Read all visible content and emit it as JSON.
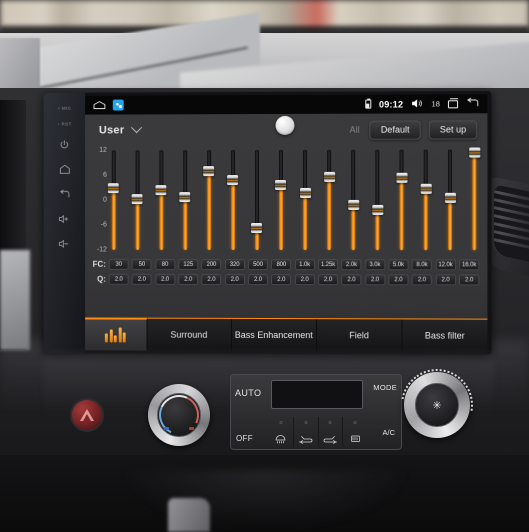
{
  "status_bar": {
    "home_icon": "home-icon",
    "app_icon": "app-shortcut-icon",
    "battery_icon": "battery-icon",
    "clock": "09:12",
    "volume_icon": "volume-icon",
    "volume_level": "18",
    "recent_icon": "recent-apps-icon",
    "back_icon": "back-arrow-icon"
  },
  "topbar": {
    "preset_label": "User",
    "chevron_icon": "chevron-down-icon",
    "center_knob_icon": "balance-knob",
    "all_label": "All",
    "default_label": "Default",
    "setup_label": "Set up"
  },
  "eq": {
    "scale_labels": [
      "12",
      "6",
      "0",
      "-6",
      "-12"
    ],
    "fc_row_label": "FC:",
    "q_row_label": "Q:",
    "bands": [
      {
        "freq": "30",
        "gain": 3.0,
        "q": "2.0"
      },
      {
        "freq": "50",
        "gain": 0.2,
        "q": "2.0"
      },
      {
        "freq": "80",
        "gain": 2.4,
        "q": "2.0"
      },
      {
        "freq": "125",
        "gain": 0.7,
        "q": "2.0"
      },
      {
        "freq": "200",
        "gain": 7.0,
        "q": "2.0"
      },
      {
        "freq": "320",
        "gain": 4.7,
        "q": "2.0"
      },
      {
        "freq": "500",
        "gain": -6.6,
        "q": "2.0"
      },
      {
        "freq": "800",
        "gain": 3.5,
        "q": "2.0"
      },
      {
        "freq": "1.0k",
        "gain": 1.7,
        "q": "2.0"
      },
      {
        "freq": "1.25k",
        "gain": 5.6,
        "q": "2.0"
      },
      {
        "freq": "2.0k",
        "gain": -1.3,
        "q": "2.0"
      },
      {
        "freq": "3.0k",
        "gain": -2.4,
        "q": "2.0"
      },
      {
        "freq": "5.0k",
        "gain": 5.2,
        "q": "2.0"
      },
      {
        "freq": "8.0k",
        "gain": 2.6,
        "q": "2.0"
      },
      {
        "freq": "12.0k",
        "gain": 0.6,
        "q": "2.0"
      },
      {
        "freq": "16.0k",
        "gain": 11.4,
        "q": "2.0"
      }
    ],
    "gain_min": -12,
    "gain_max": 12,
    "accent_color": "#ff8c0f"
  },
  "tabs": [
    {
      "label": "",
      "icon": "equalizer-icon",
      "active": true
    },
    {
      "label": "Surround",
      "icon": "",
      "active": false
    },
    {
      "label": "Bass Enhancement",
      "icon": "",
      "active": false
    },
    {
      "label": "Field",
      "icon": "",
      "active": false
    },
    {
      "label": "Bass filter",
      "icon": "",
      "active": false
    }
  ],
  "hardware_buttons": [
    {
      "label": "MIC",
      "icon": "mic-indicator"
    },
    {
      "label": "RST",
      "icon": "reset-indicator"
    },
    {
      "label": "",
      "icon": "power-icon"
    },
    {
      "label": "",
      "icon": "home-icon"
    },
    {
      "label": "",
      "icon": "back-icon"
    },
    {
      "label": "",
      "icon": "volume-up-icon"
    },
    {
      "label": "",
      "icon": "volume-down-icon"
    }
  ],
  "climate": {
    "hazard_icon": "hazard-triangle-icon",
    "temp_knob_icon": "temperature-knob",
    "auto_label": "AUTO",
    "mode_label": "MODE",
    "off_label": "OFF",
    "ac_label": "A/C",
    "display_text": "",
    "buttons": [
      {
        "icon": "front-defrost-icon"
      },
      {
        "icon": "recirculate-air-icon"
      },
      {
        "icon": "fresh-air-icon"
      },
      {
        "icon": "rear-defrost-icon"
      }
    ],
    "fan_knob_icon": "fan-speed-knob",
    "fan_glyph": "✳"
  }
}
